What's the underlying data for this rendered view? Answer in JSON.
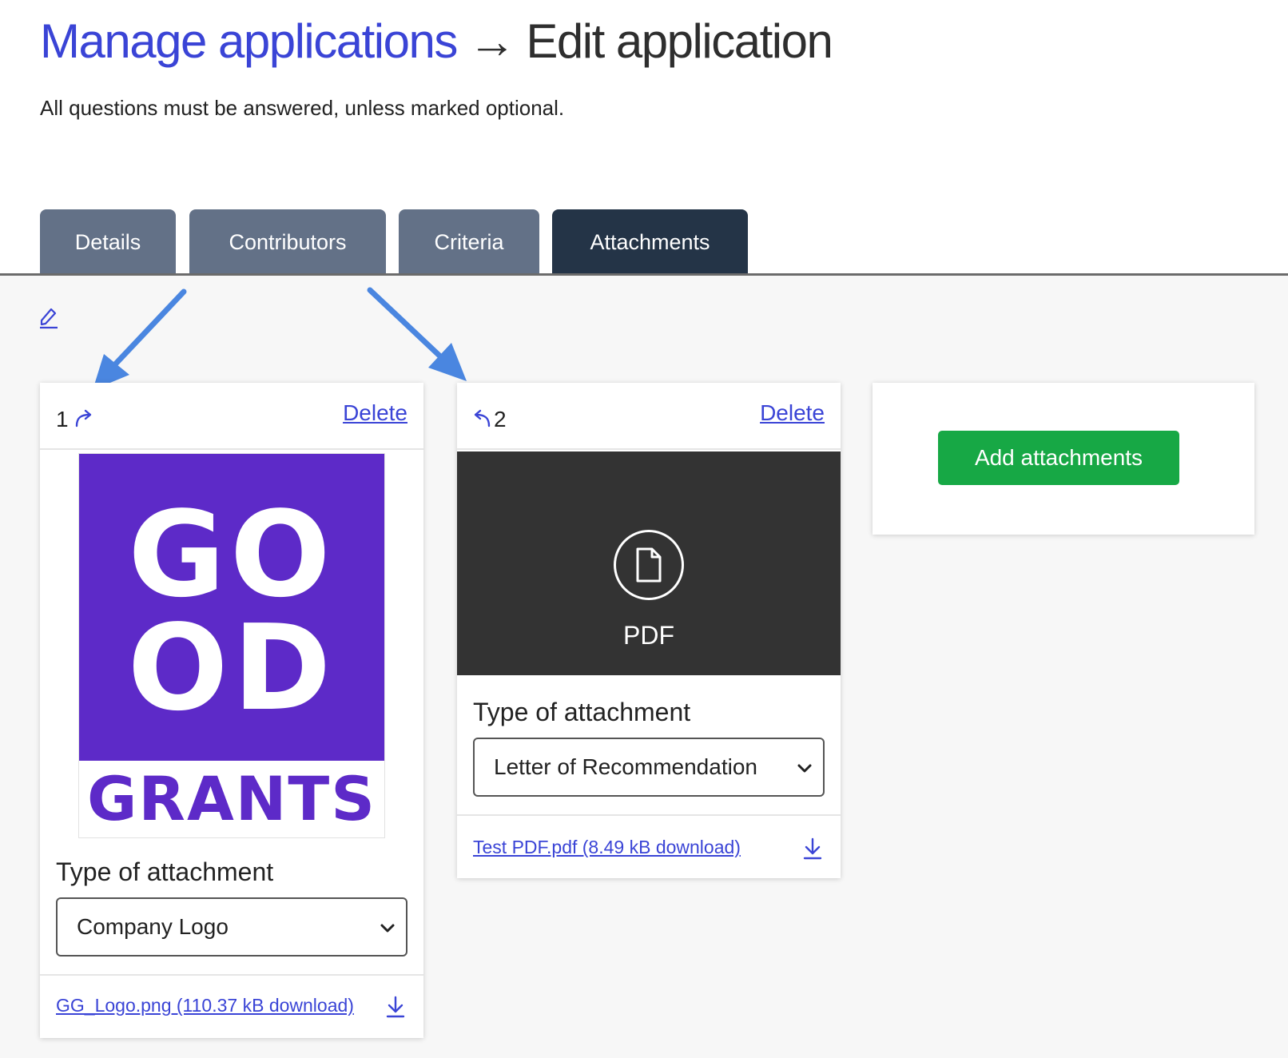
{
  "header": {
    "breadcrumb_link": "Manage applications",
    "breadcrumb_separator": "→",
    "breadcrumb_current": "Edit application",
    "intro": "All questions must be answered, unless marked optional."
  },
  "tabs": [
    {
      "label": "Details",
      "active": false
    },
    {
      "label": "Contributors",
      "active": false
    },
    {
      "label": "Criteria",
      "active": false
    },
    {
      "label": "Attachments",
      "active": true
    }
  ],
  "toolbar": {
    "edit_icon": "pencil-icon"
  },
  "attachments": [
    {
      "number": "1",
      "move_icon": "move-right-arrow-icon",
      "delete_label": "Delete",
      "preview": {
        "type": "image",
        "logo_lines": [
          "GO",
          "OD"
        ],
        "logo_word": "GRANTS"
      },
      "type_label": "Type of attachment",
      "selected_type": "Company Logo",
      "file_link": "GG_Logo.png (110.37 kB download)",
      "download_icon": "download-icon"
    },
    {
      "number": "2",
      "move_icon": "move-left-arrow-icon",
      "delete_label": "Delete",
      "preview": {
        "type": "pdf",
        "label": "PDF",
        "icon": "file-icon"
      },
      "type_label": "Type of attachment",
      "selected_type": "Letter of Recommendation",
      "file_link": "Test PDF.pdf (8.49 kB download)",
      "download_icon": "download-icon"
    }
  ],
  "add_panel": {
    "button_label": "Add attachments"
  },
  "colors": {
    "link": "#3a44d6",
    "tab_inactive": "#637187",
    "tab_active": "#243447",
    "logo_purple": "#5d2ac8",
    "add_button": "#17a845",
    "annotation_arrow": "#4a86e0"
  }
}
